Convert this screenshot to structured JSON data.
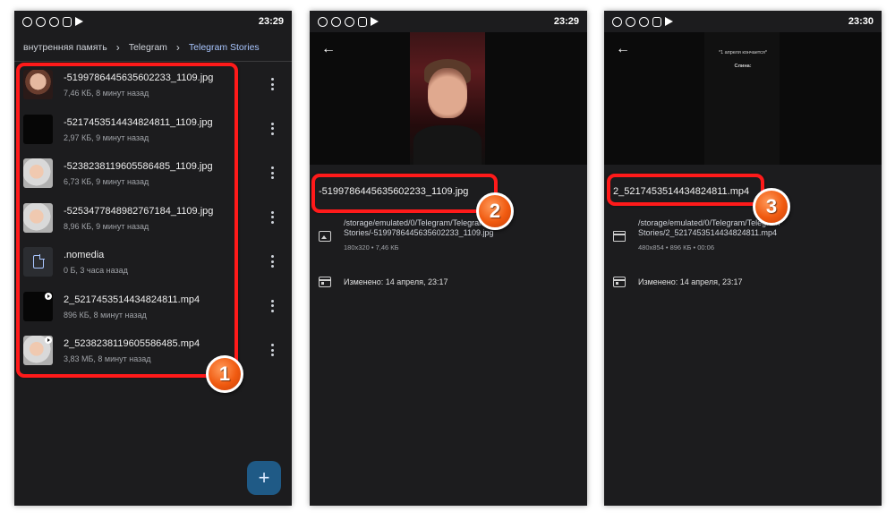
{
  "panels": [
    {
      "status": {
        "time": "23:29"
      },
      "breadcrumb": [
        "внутренняя память",
        "Telegram",
        "Telegram Stories"
      ],
      "files": [
        {
          "name": "-5199786445635602233_1109.jpg",
          "meta": "7,46 КБ, 8 минут назад",
          "thumb": "face"
        },
        {
          "name": "-5217453514434824811_1109.jpg",
          "meta": "2,97 КБ, 9 минут назад",
          "thumb": "dark"
        },
        {
          "name": "-5238238119605586485_1109.jpg",
          "meta": "6,73 КБ, 9 минут назад",
          "thumb": "face2"
        },
        {
          "name": "-5253477848982767184_1109.jpg",
          "meta": "8,96 КБ, 9 минут назад",
          "thumb": "face2"
        },
        {
          "name": ".nomedia",
          "meta": "0 Б, 3 часа назад",
          "thumb": "doc"
        },
        {
          "name": "2_5217453514434824811.mp4",
          "meta": "896 КБ, 8 минут назад",
          "thumb": "dark"
        },
        {
          "name": "2_5238238119605586485.mp4",
          "meta": "3,83 МБ, 8 минут назад",
          "thumb": "face2"
        }
      ],
      "fab": "+",
      "badge": "1"
    },
    {
      "status": {
        "time": "23:29"
      },
      "title": "-5199786445635602233_1109.jpg",
      "path": "/storage/emulated/0/Telegram/Telegram Stories/-5199786445635602233_1109.jpg",
      "sub": "180x320  •  7,46 КБ",
      "modified": "Изменено: 14 апреля, 23:17",
      "badge": "2"
    },
    {
      "status": {
        "time": "23:30"
      },
      "title": "2_5217453514434824811.mp4",
      "caption": "*1 апреля кончается*",
      "caption2": "Слина:",
      "path": "/storage/emulated/0/Telegram/Telegram Stories/2_5217453514434824811.mp4",
      "sub": "480x854  •  896 КБ  •  00:06",
      "modified": "Изменено: 14 апреля, 23:17",
      "badge": "3"
    }
  ],
  "colors": {
    "highlight": "#ff1a1a",
    "badge": "#f05a10",
    "accent": "#a9c6ff",
    "background": "#1c1c1e"
  }
}
